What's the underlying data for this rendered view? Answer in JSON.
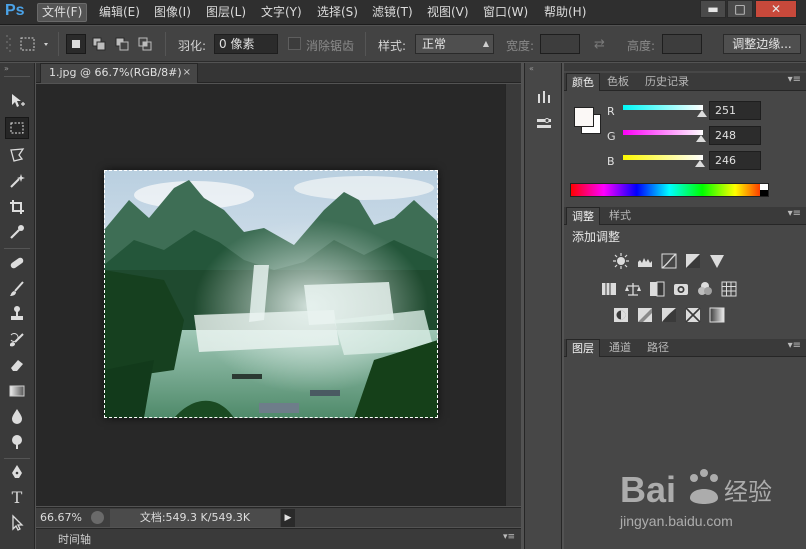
{
  "app": {
    "logo": "Ps"
  },
  "menu": [
    "文件(F)",
    "编辑(E)",
    "图像(I)",
    "图层(L)",
    "文字(Y)",
    "选择(S)",
    "滤镜(T)",
    "视图(V)",
    "窗口(W)",
    "帮助(H)"
  ],
  "window_controls": {
    "minimize": "▬",
    "maximize": "□",
    "close": "✕"
  },
  "options": {
    "feather_label": "羽化:",
    "feather_value": "0 像素",
    "antialias_label": "消除锯齿",
    "style_label": "样式:",
    "style_value": "正常",
    "width_label": "宽度:",
    "height_label": "高度:",
    "refine_edge": "调整边缘..."
  },
  "document": {
    "tab_title": "1.jpg @ 66.7%(RGB/8#)",
    "tab_close": "×",
    "zoom": "66.67%",
    "doc_info": "文档:549.3 K/549.3K",
    "status_arrow": "▶",
    "timeline_tab": "时间轴"
  },
  "tools": [
    "move-tool",
    "rectangular-marquee-tool",
    "lasso-tool",
    "magic-wand-tool",
    "crop-tool",
    "eyedropper-tool",
    "spot-healing-brush-tool",
    "brush-tool",
    "clone-stamp-tool",
    "history-brush-tool",
    "eraser-tool",
    "gradient-tool",
    "blur-tool",
    "dodge-tool",
    "pen-tool",
    "type-tool",
    "path-selection-tool"
  ],
  "color_panel": {
    "tabs": [
      "颜色",
      "色板",
      "历史记录"
    ],
    "active_tab": "颜色",
    "r_label": "R",
    "g_label": "G",
    "b_label": "B",
    "r": "251",
    "g": "248",
    "b": "246",
    "r_level": 0.984,
    "g_level": 0.973,
    "b_level": 0.965
  },
  "adjustments_panel": {
    "tabs": [
      "调整",
      "样式"
    ],
    "active_tab": "调整",
    "heading": "添加调整"
  },
  "layers_panel": {
    "tabs": [
      "图层",
      "通道",
      "路径"
    ],
    "active_tab": "图层"
  },
  "watermark": {
    "brand": "Bai 经验",
    "site": "jingyan.baidu.com"
  },
  "colors": {
    "accent": "#4ba3e8",
    "close": "#c8493b",
    "background": "#535353",
    "canvas_bg": "#282828"
  }
}
